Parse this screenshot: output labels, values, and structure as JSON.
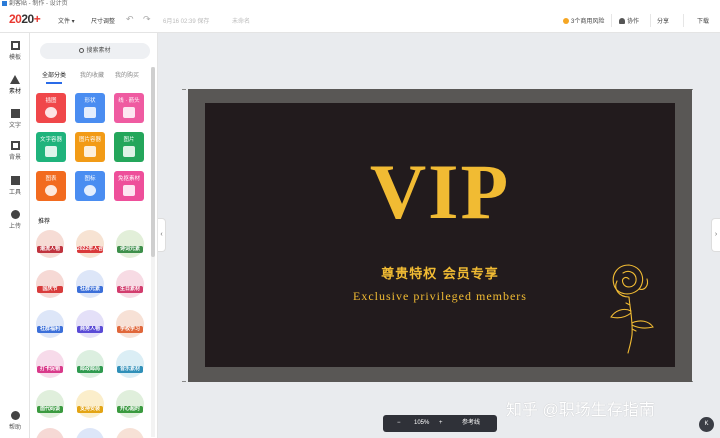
{
  "titlebar": {
    "text": "創客貼 - 制作 - 设计页"
  },
  "topbar": {
    "logo_main": "20",
    "logo_accent": "20",
    "logo_suffix": "+",
    "file_menu": "文件 ▾",
    "resize": "尺寸调整",
    "save_status": "6月16  02:39 保存",
    "doc_name": "未命名",
    "risk": "3个商用风险",
    "collaborate": "协作",
    "share": "分享",
    "download": "下载"
  },
  "rail": {
    "items": [
      {
        "label": "模板",
        "icon": "template-icon"
      },
      {
        "label": "素材",
        "icon": "shapes-icon"
      },
      {
        "label": "文字",
        "icon": "text-icon"
      },
      {
        "label": "背景",
        "icon": "background-icon"
      },
      {
        "label": "工具",
        "icon": "toolbox-icon"
      },
      {
        "label": "上传",
        "icon": "upload-cloud-icon"
      }
    ],
    "help": "帮助"
  },
  "panel": {
    "search_label": "搜索素材",
    "tabs": [
      "全部分类",
      "我的收藏",
      "我的购买"
    ],
    "tiles": [
      {
        "label": "插图",
        "color": "#f0474a"
      },
      {
        "label": "形状",
        "color": "#4a8df1"
      },
      {
        "label": "线 · 箭头",
        "color": "#ef5ba1"
      },
      {
        "label": "文字容器",
        "color": "#1fb37c"
      },
      {
        "label": "图片容器",
        "color": "#f29b16"
      },
      {
        "label": "图片",
        "color": "#24a65b"
      },
      {
        "label": "图表",
        "color": "#f26b1f"
      },
      {
        "label": "图标",
        "color": "#4a8df1"
      },
      {
        "label": "免抠素材",
        "color": "#ee4f9a"
      }
    ],
    "section_title": "推荐",
    "stickers": [
      {
        "label": "潮流人物",
        "color": "#c0333e"
      },
      {
        "label": "2022年人合",
        "color": "#d9393a"
      },
      {
        "label": "诗词元素",
        "color": "#3d8f4a"
      },
      {
        "label": "国庆节",
        "color": "#d83b3b"
      },
      {
        "label": "社群元素",
        "color": "#3b6fd9"
      },
      {
        "label": "生日素材",
        "color": "#d23c6d"
      },
      {
        "label": "社群福利",
        "color": "#3b6fd9"
      },
      {
        "label": "商务人物",
        "color": "#5a4bd6"
      },
      {
        "label": "学校学习",
        "color": "#e0673a"
      },
      {
        "label": "打卡促销",
        "color": "#d9398a"
      },
      {
        "label": "邮政邮局",
        "color": "#2f9a4f"
      },
      {
        "label": "音乐素材",
        "color": "#2f8fb8"
      },
      {
        "label": "面代码谈",
        "color": "#3a9a3f"
      },
      {
        "label": "支持安装",
        "color": "#e3a414"
      },
      {
        "label": "开心超时",
        "color": "#3a9a3f"
      },
      {
        "label": "",
        "color": "#d9393a"
      },
      {
        "label": "",
        "color": "#3b6fd9"
      },
      {
        "label": "",
        "color": "#e0673a"
      }
    ]
  },
  "card": {
    "title": "VIP",
    "subtitle_cn": "尊贵特权  会员专享",
    "subtitle_en": "Exclusive privileged members",
    "gold": "#f1bb33",
    "bg": "#221b1d",
    "frame": "#595755"
  },
  "zoombar": {
    "minus": "−",
    "zoom": "105%",
    "plus": "+",
    "guides": "参考线"
  },
  "watermark": "知乎 @职场生存指南",
  "corner_button": "K"
}
